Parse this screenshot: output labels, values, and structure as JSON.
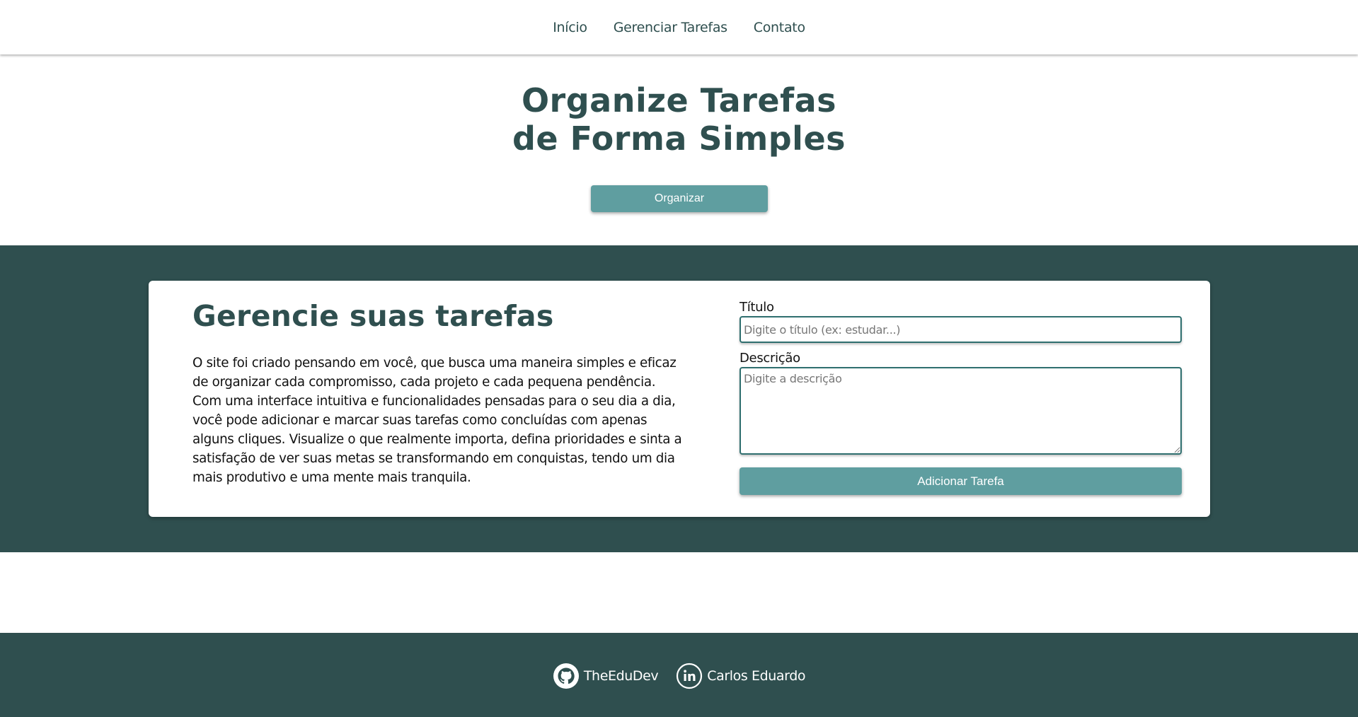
{
  "nav": {
    "items": [
      {
        "label": "Início"
      },
      {
        "label": "Gerenciar Tarefas"
      },
      {
        "label": "Contato"
      }
    ]
  },
  "hero": {
    "title_line1": "Organize Tarefas",
    "title_line2": "de Forma Simples",
    "button_label": "Organizar"
  },
  "manage": {
    "heading": "Gerencie suas tarefas",
    "description": "O site foi criado pensando em você, que busca uma maneira simples e eficaz de organizar cada compromisso, cada projeto e cada pequena pendência. Com uma interface intuitiva e funcionalidades pensadas para o seu dia a dia, você pode adicionar e marcar suas tarefas como concluídas com apenas alguns cliques. Visualize o que realmente importa, defina prioridades e sinta a satisfação de ver suas metas se transformando em conquistas, tendo um dia mais produtivo e uma mente mais tranquila.",
    "form": {
      "title_label": "Título",
      "title_value": "",
      "title_placeholder": "Digite o título (ex: estudar...)",
      "description_label": "Descrição",
      "description_value": "",
      "description_placeholder": "Digite a descrição",
      "submit_label": "Adicionar Tarefa"
    }
  },
  "footer": {
    "github": {
      "label": "TheEduDev",
      "icon": "github-icon"
    },
    "linkedin": {
      "label": "Carlos Eduardo",
      "icon": "linkedin-icon"
    }
  },
  "colors": {
    "primary_dark": "#2f4f4f",
    "accent": "#5f9ea0",
    "background": "#ffffff"
  }
}
